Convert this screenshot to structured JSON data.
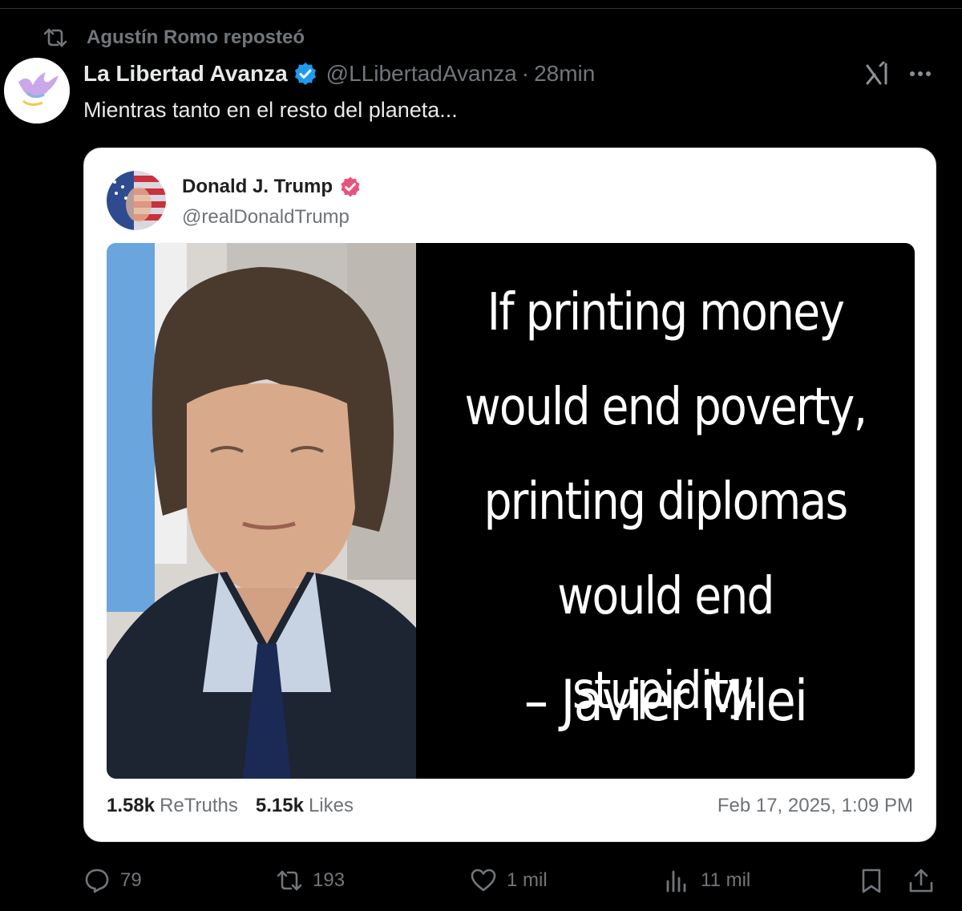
{
  "repost": {
    "label": "Agustín Romo reposteó"
  },
  "post": {
    "author_name": "La Libertad Avanza",
    "author_handle": "@LLibertadAvanza",
    "separator": "·",
    "time": "28min",
    "text": "Mientras tanto en el resto del planeta..."
  },
  "quoted": {
    "author_name": "Donald J. Trump",
    "author_handle": "@realDonaldTrump",
    "quote_lines": [
      "If printing money",
      "would end poverty,",
      "printing diplomas",
      "would end stupidity."
    ],
    "quote_author": "– Javier Milei",
    "retruths_count": "1.58k",
    "retruths_label": "ReTruths",
    "likes_count": "5.15k",
    "likes_label": "Likes",
    "date": "Feb 17, 2025, 1:09 PM"
  },
  "actions": {
    "replies": "79",
    "reposts": "193",
    "likes": "1 mil",
    "views": "11 mil"
  },
  "colors": {
    "background": "#000000",
    "muted": "#71767b",
    "verified_blue": "#1d9bf0",
    "truth_badge": "#e8537e"
  },
  "icons": [
    "repost-icon",
    "verified-badge-icon",
    "grok-icon",
    "more-icon",
    "reply-icon",
    "repost-icon",
    "like-icon",
    "views-icon",
    "bookmark-icon",
    "share-icon"
  ]
}
